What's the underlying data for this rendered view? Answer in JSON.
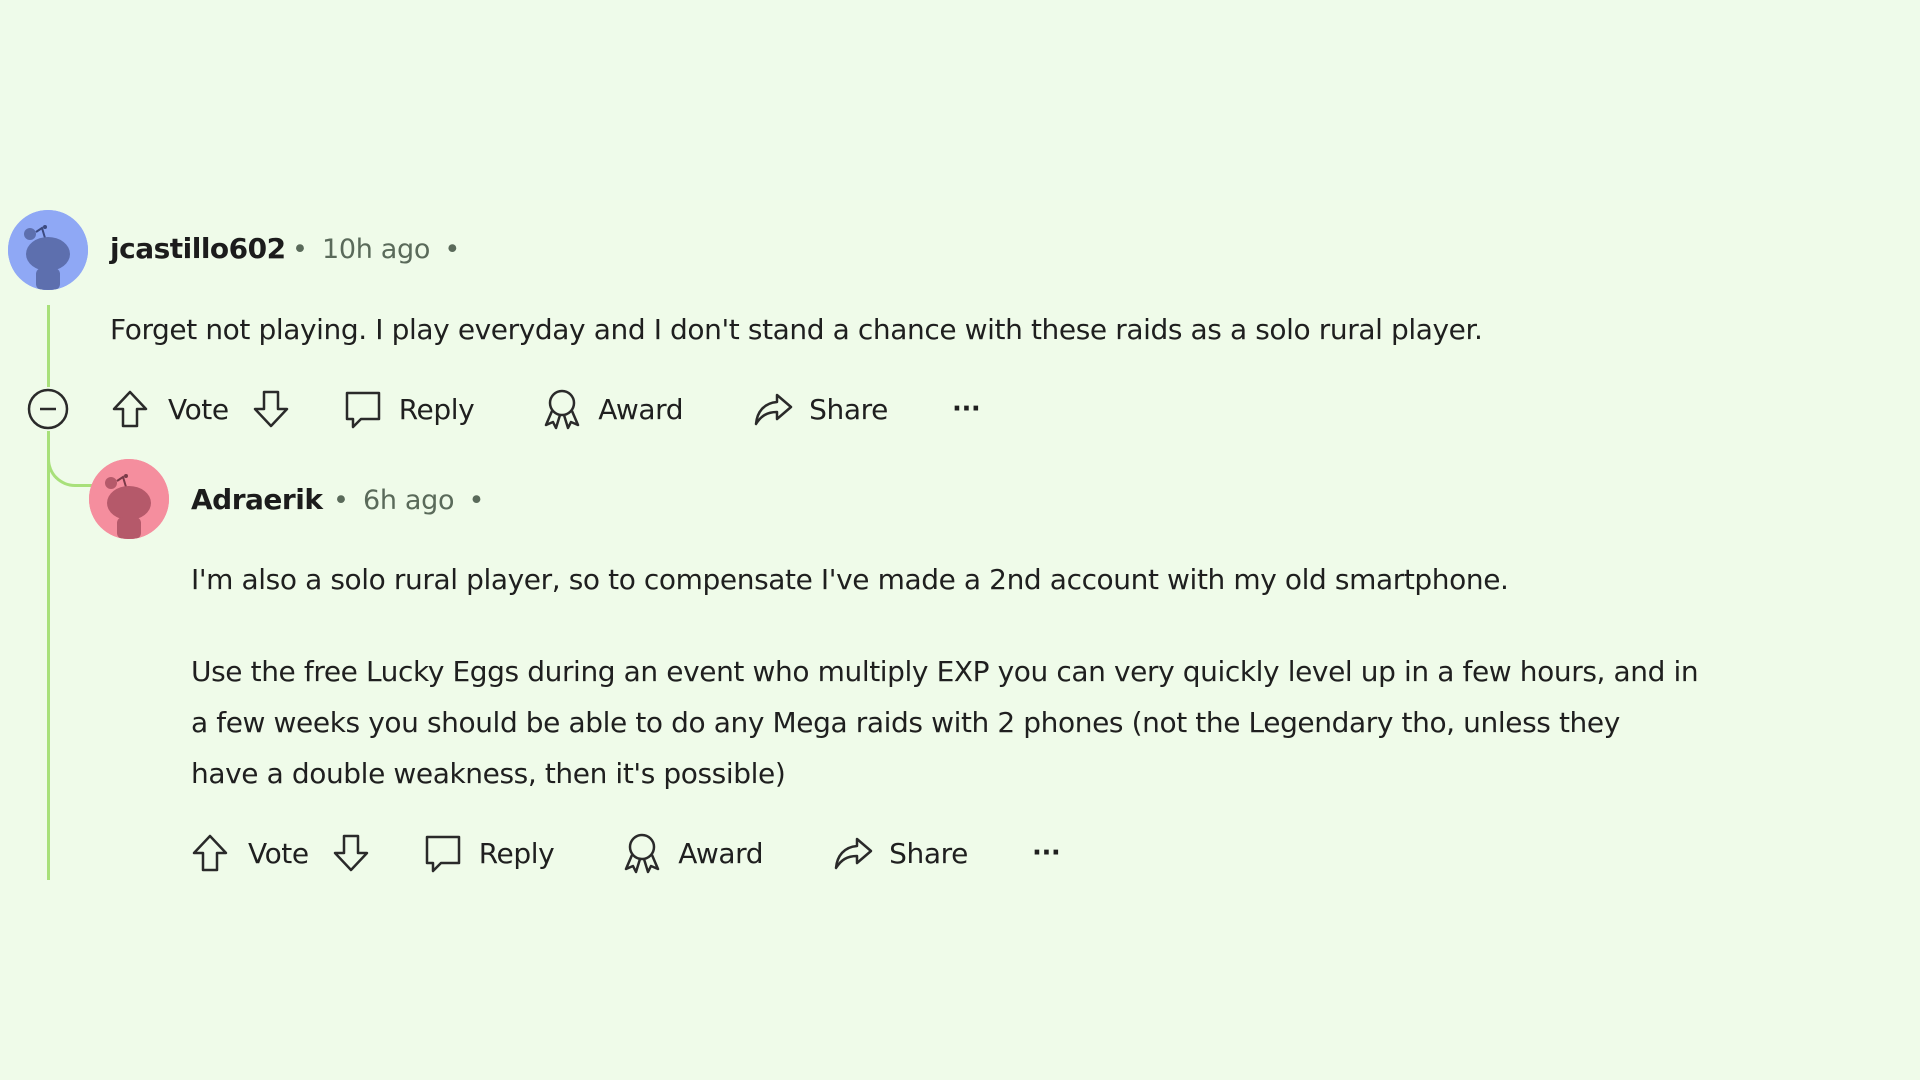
{
  "theme": {
    "background": "#effbe9",
    "thread_line": "#a8e07a",
    "avatar_blue": "#8fa8f5",
    "avatar_pink": "#f58e9e"
  },
  "comments": [
    {
      "username": "jcastillo602",
      "timestamp": "10h ago",
      "separator": "•",
      "avatar_icon": "reddit-snoo-avatar-blue",
      "body": [
        "Forget not playing. I play everyday and I don't stand a chance with these raids as a solo rural player."
      ],
      "actions": {
        "collapse_icon": "collapse-minus-circle-icon",
        "upvote_icon": "arrow-up-icon",
        "vote_label": "Vote",
        "downvote_icon": "arrow-down-icon",
        "reply_icon": "speech-bubble-icon",
        "reply_label": "Reply",
        "award_icon": "award-ribbon-icon",
        "award_label": "Award",
        "share_icon": "share-arrow-icon",
        "share_label": "Share",
        "more_label": "···"
      }
    },
    {
      "username": "Adraerik",
      "timestamp": "6h ago",
      "separator": "•",
      "avatar_icon": "reddit-snoo-avatar-pink",
      "body": [
        "I'm also a solo rural player, so to compensate I've made a 2nd account with my old smartphone.",
        "Use the free Lucky Eggs during an event who multiply EXP you can very quickly level up in a few hours, and in",
        "a few weeks you should be able to do any Mega raids with 2 phones (not the Legendary tho, unless they",
        "have a double weakness, then it's possible)"
      ],
      "actions": {
        "upvote_icon": "arrow-up-icon",
        "vote_label": "Vote",
        "downvote_icon": "arrow-down-icon",
        "reply_icon": "speech-bubble-icon",
        "reply_label": "Reply",
        "award_icon": "award-ribbon-icon",
        "award_label": "Award",
        "share_icon": "share-arrow-icon",
        "share_label": "Share",
        "more_label": "···"
      }
    }
  ]
}
